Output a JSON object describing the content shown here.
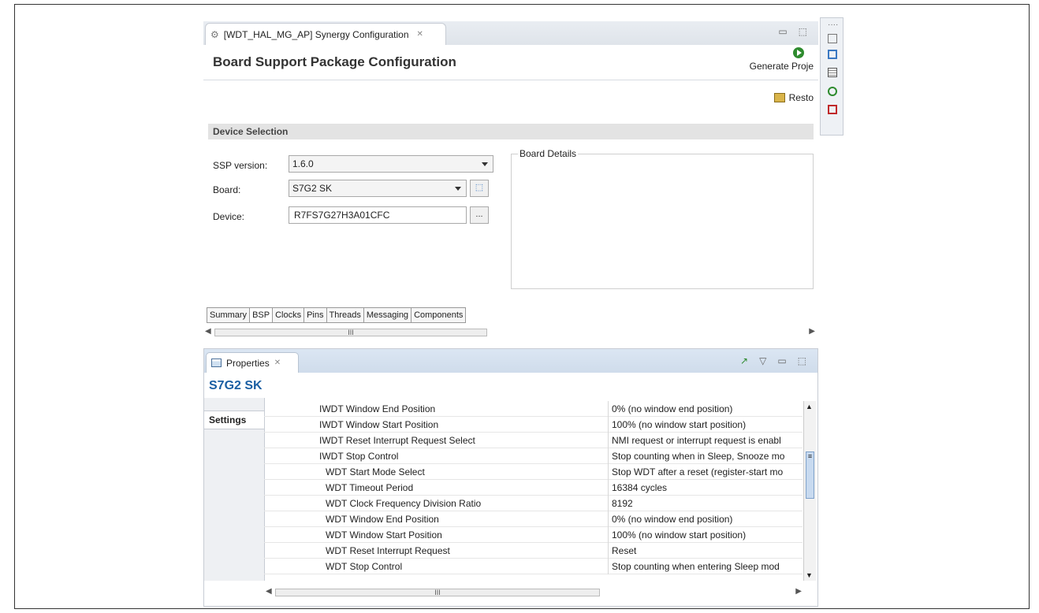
{
  "editor": {
    "tab_title": "[WDT_HAL_MG_AP] Synergy Configuration",
    "tab_close": "✕",
    "window_controls": [
      "▭",
      "⬚"
    ],
    "page_title": "Board Support Package Configuration",
    "generate_label": "Generate Proje",
    "restore_label": "Resto"
  },
  "device_selection": {
    "header": "Device Selection",
    "ssp_label": "SSP version:",
    "ssp_value": "1.6.0",
    "board_label": "Board:",
    "board_value": "S7G2 SK",
    "device_label": "Device:",
    "device_value": "R7FS7G27H3A01CFC",
    "browse_label": "...",
    "board_details_label": "Board Details"
  },
  "subtabs": [
    "Summary",
    "BSP",
    "Clocks",
    "Pins",
    "Threads",
    "Messaging",
    "Components"
  ],
  "scroll_mark": "III",
  "properties": {
    "tab_label": "Properties",
    "tab_close": "✕",
    "title": "S7G2 SK",
    "sidebar_tab": "Settings",
    "rows": [
      {
        "name": "IWDT Window End Position",
        "value": "0% (no window end position)"
      },
      {
        "name": "IWDT Window Start Position",
        "value": "100% (no window start position)"
      },
      {
        "name": "IWDT Reset Interrupt Request Select",
        "value": "NMI request or interrupt request is enabl"
      },
      {
        "name": "IWDT Stop Control",
        "value": "Stop counting when in Sleep, Snooze mo"
      },
      {
        "name": "WDT Start Mode Select",
        "value": "Stop WDT after a reset (register-start mo"
      },
      {
        "name": "WDT Timeout Period",
        "value": "16384 cycles"
      },
      {
        "name": "WDT Clock Frequency Division Ratio",
        "value": "8192"
      },
      {
        "name": "WDT Window End Position",
        "value": "0% (no window end position)"
      },
      {
        "name": "WDT Window Start Position",
        "value": "100% (no window start position)"
      },
      {
        "name": "WDT Reset Interrupt Request",
        "value": "Reset"
      },
      {
        "name": "WDT Stop Control",
        "value": "Stop counting when entering Sleep mod"
      }
    ]
  },
  "colors": {
    "accent_title": "#1b5fa3",
    "generate_icon": "#2e8b2e"
  }
}
